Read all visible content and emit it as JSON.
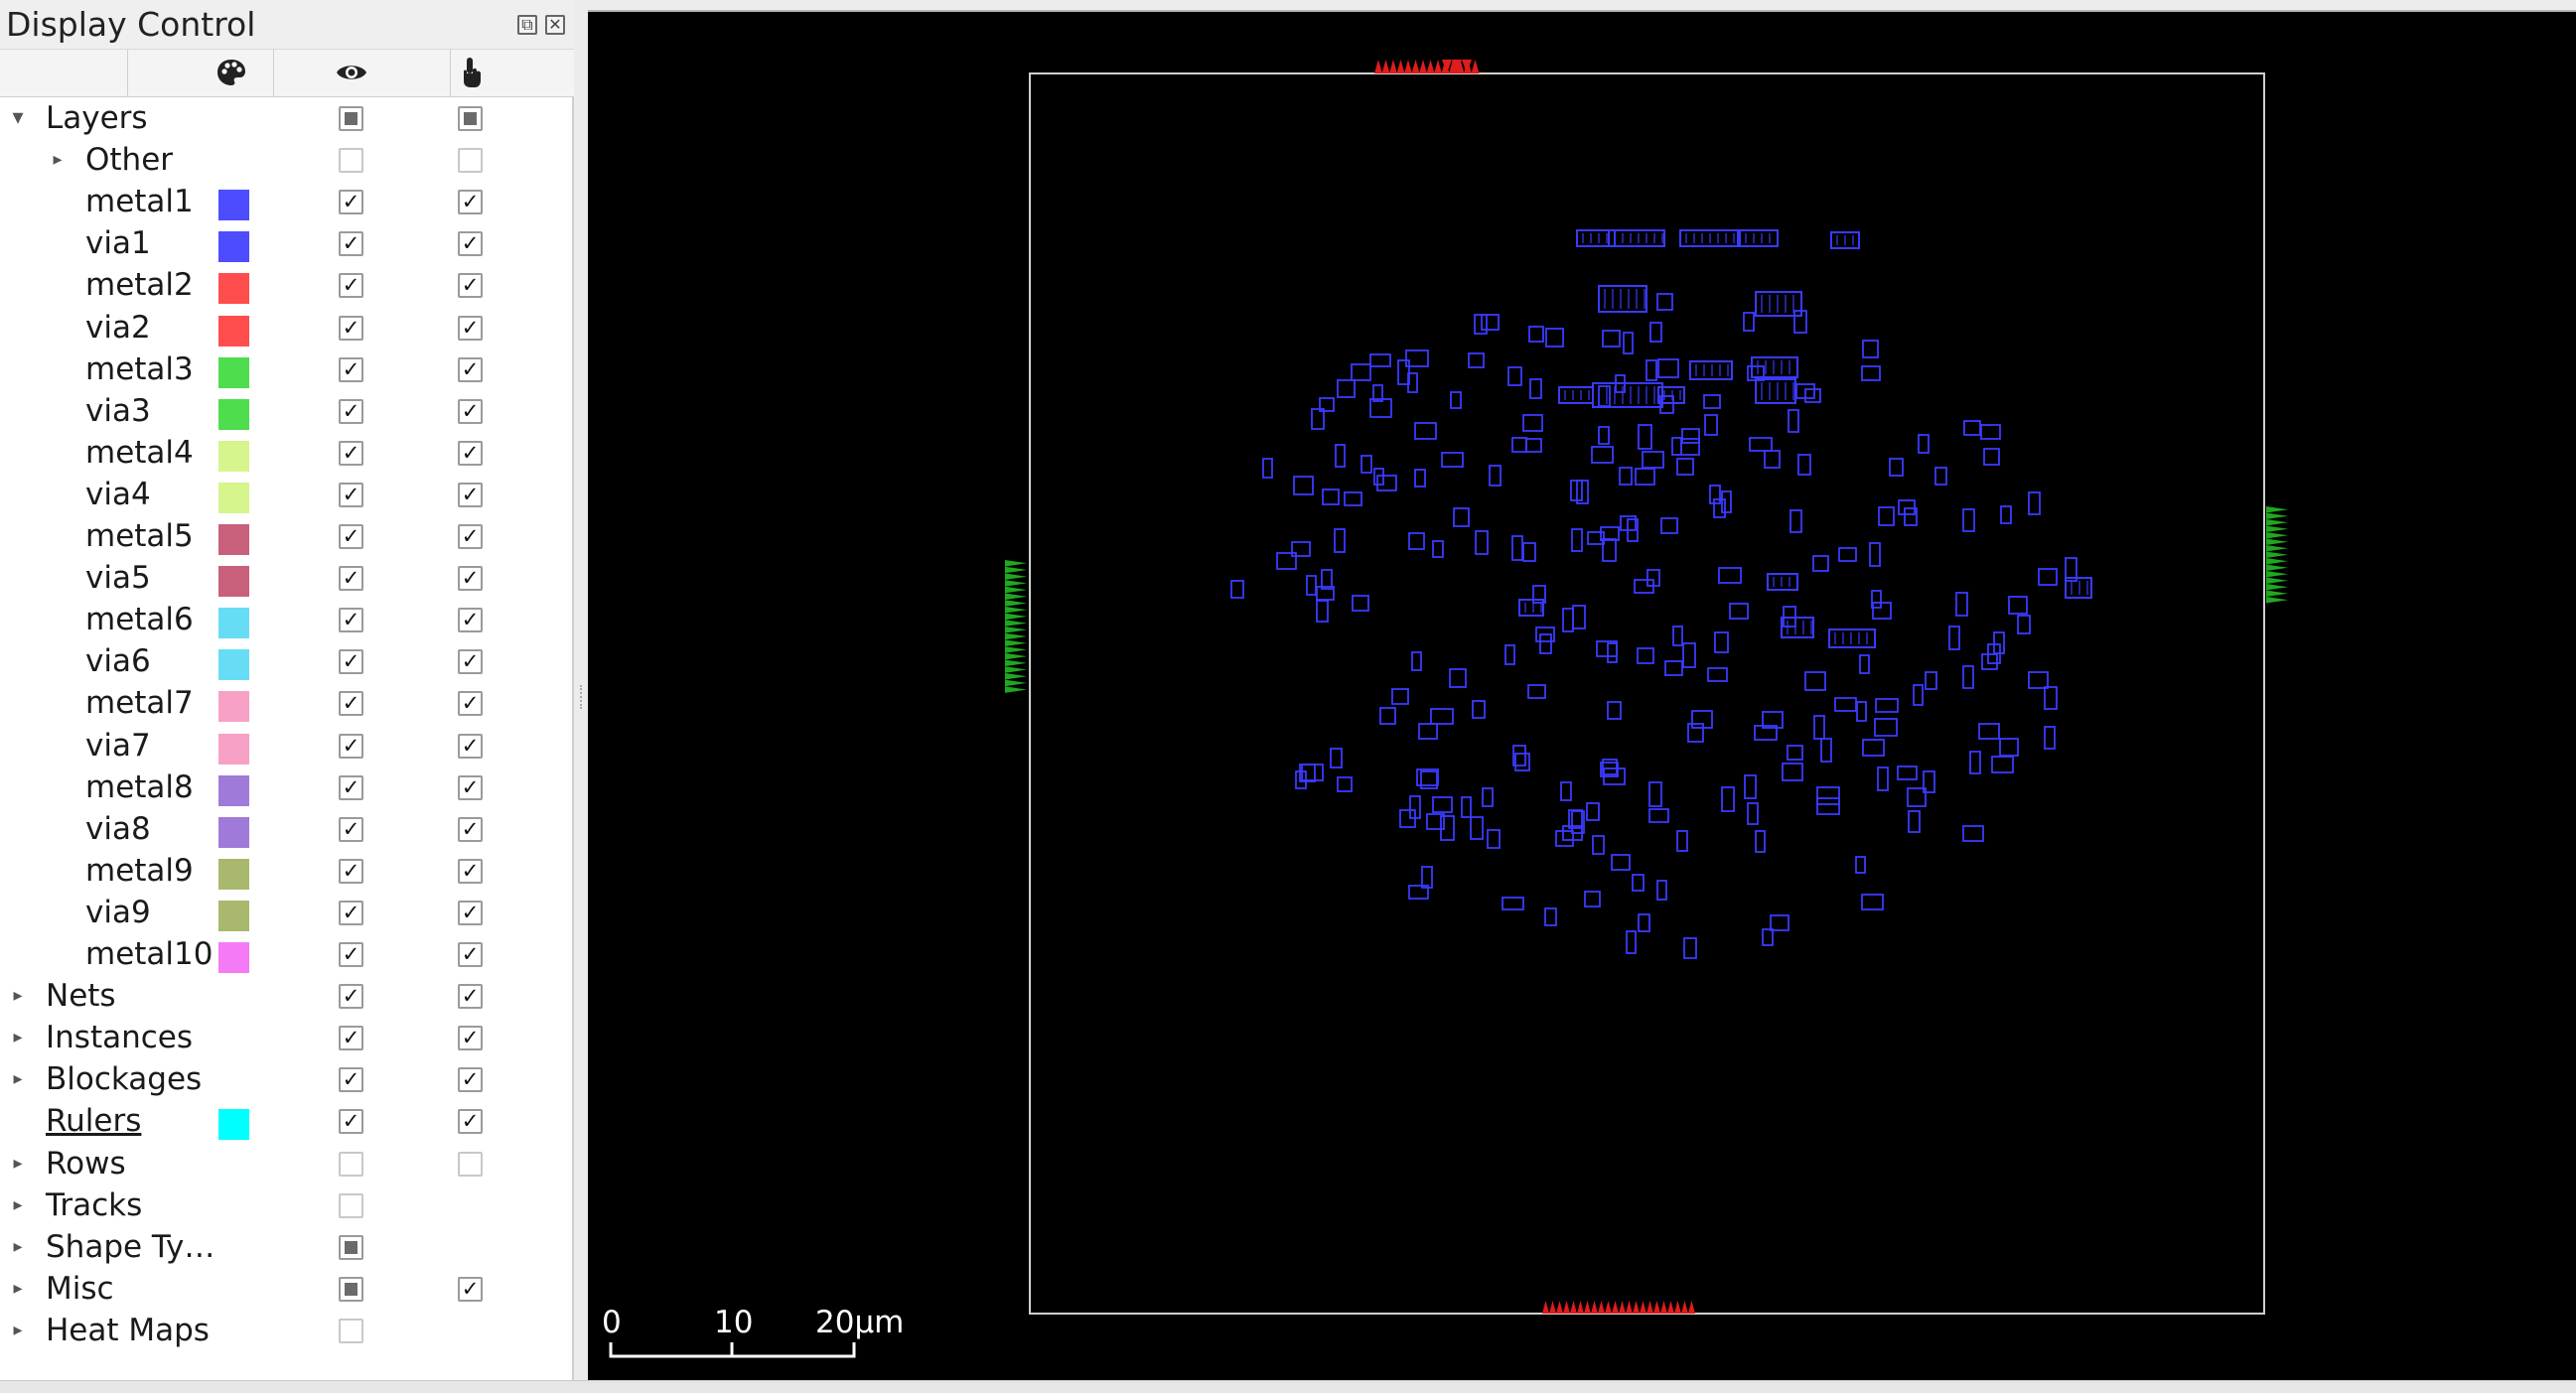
{
  "dock": {
    "title": "Display Control",
    "float_button": "⧉",
    "close_button": "✕",
    "columns": {
      "color_icon": "palette-icon",
      "visible_icon": "eye-icon",
      "selectable_icon": "pointer-hand-icon"
    }
  },
  "tree": [
    {
      "label": "Layers",
      "level": 0,
      "arrow": "down",
      "visible": "partial",
      "selectable": "partial"
    },
    {
      "label": "Other",
      "level": 1,
      "arrow": "right",
      "visible": "unchecked",
      "selectable": "unchecked"
    },
    {
      "label": "metal1",
      "level": 1,
      "color": "#4d4dff",
      "visible": "checked",
      "selectable": "checked"
    },
    {
      "label": "via1",
      "level": 1,
      "color": "#4d4dff",
      "visible": "checked",
      "selectable": "checked"
    },
    {
      "label": "metal2",
      "level": 1,
      "color": "#ff4d4d",
      "visible": "checked",
      "selectable": "checked"
    },
    {
      "label": "via2",
      "level": 1,
      "color": "#ff4d4d",
      "visible": "checked",
      "selectable": "checked"
    },
    {
      "label": "metal3",
      "level": 1,
      "color": "#4ddd4d",
      "visible": "checked",
      "selectable": "checked"
    },
    {
      "label": "via3",
      "level": 1,
      "color": "#4ddd4d",
      "visible": "checked",
      "selectable": "checked"
    },
    {
      "label": "metal4",
      "level": 1,
      "color": "#d6f58c",
      "visible": "checked",
      "selectable": "checked"
    },
    {
      "label": "via4",
      "level": 1,
      "color": "#d6f58c",
      "visible": "checked",
      "selectable": "checked"
    },
    {
      "label": "metal5",
      "level": 1,
      "color": "#c8607c",
      "visible": "checked",
      "selectable": "checked"
    },
    {
      "label": "via5",
      "level": 1,
      "color": "#c8607c",
      "visible": "checked",
      "selectable": "checked"
    },
    {
      "label": "metal6",
      "level": 1,
      "color": "#66ddf5",
      "visible": "checked",
      "selectable": "checked"
    },
    {
      "label": "via6",
      "level": 1,
      "color": "#66ddf5",
      "visible": "checked",
      "selectable": "checked"
    },
    {
      "label": "metal7",
      "level": 1,
      "color": "#f7a1c6",
      "visible": "checked",
      "selectable": "checked"
    },
    {
      "label": "via7",
      "level": 1,
      "color": "#f7a1c6",
      "visible": "checked",
      "selectable": "checked"
    },
    {
      "label": "metal8",
      "level": 1,
      "color": "#a07ad8",
      "visible": "checked",
      "selectable": "checked"
    },
    {
      "label": "via8",
      "level": 1,
      "color": "#a07ad8",
      "visible": "checked",
      "selectable": "checked"
    },
    {
      "label": "metal9",
      "level": 1,
      "color": "#a8b86c",
      "visible": "checked",
      "selectable": "checked"
    },
    {
      "label": "via9",
      "level": 1,
      "color": "#a8b86c",
      "visible": "checked",
      "selectable": "checked"
    },
    {
      "label": "metal10",
      "level": 1,
      "color": "#f57af5",
      "visible": "checked",
      "selectable": "checked"
    },
    {
      "label": "Nets",
      "level": 0,
      "arrow": "right",
      "visible": "checked",
      "selectable": "checked"
    },
    {
      "label": "Instances",
      "level": 0,
      "arrow": "right",
      "visible": "checked",
      "selectable": "checked"
    },
    {
      "label": "Blockages",
      "level": 0,
      "arrow": "right",
      "visible": "checked",
      "selectable": "checked"
    },
    {
      "label": "Rulers",
      "level": 0,
      "underline": true,
      "color": "#00ffff",
      "visible": "checked",
      "selectable": "checked"
    },
    {
      "label": "Rows",
      "level": 0,
      "arrow": "right",
      "visible": "unchecked",
      "selectable": "unchecked"
    },
    {
      "label": "Tracks",
      "level": 0,
      "arrow": "right",
      "visible": "unchecked"
    },
    {
      "label": "Shape Ty…",
      "level": 0,
      "arrow": "right",
      "visible": "partial"
    },
    {
      "label": "Misc",
      "level": 0,
      "arrow": "right",
      "visible": "partial",
      "selectable": "checked"
    },
    {
      "label": "Heat Maps",
      "level": 0,
      "arrow": "right",
      "visible": "unchecked"
    }
  ],
  "scale_bar": {
    "labels": [
      "0",
      "10",
      "20µm"
    ]
  },
  "colors": {
    "shape_outline": "#3a3aff",
    "pin_top_bottom": "#e01c1c",
    "pin_left_right": "#1fa81f",
    "die_outline": "#d0d0d0"
  }
}
